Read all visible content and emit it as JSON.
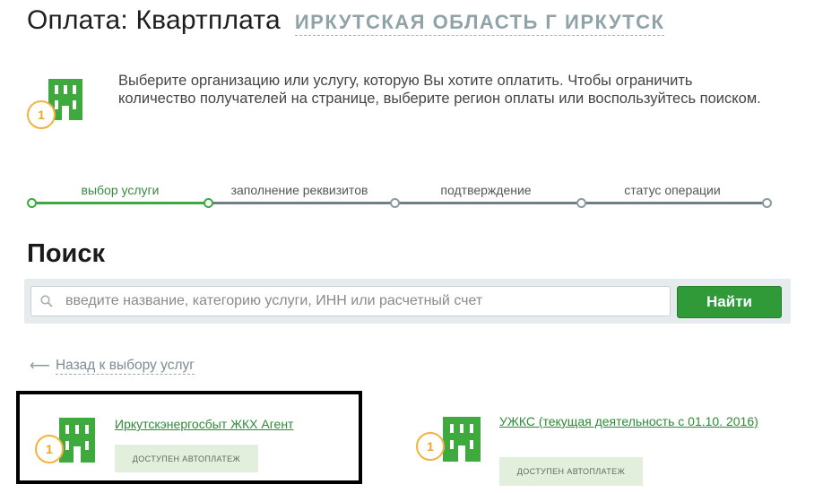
{
  "header": {
    "title": "Оплата: Квартплата",
    "region": "ИРКУТСКАЯ ОБЛАСТЬ Г ИРКУТСК"
  },
  "intro": {
    "text": "Выберите организацию или услугу, которую Вы хотите оплатить. Чтобы ограничить количество получателей на странице, выберите регион оплаты или воспользуйтесь поиском.",
    "icon_number": "1"
  },
  "steps": [
    {
      "label": "выбор услуги",
      "state": "active"
    },
    {
      "label": "заполнение реквизитов",
      "state": "pending"
    },
    {
      "label": "подтверждение",
      "state": "pending"
    },
    {
      "label": "статус операции",
      "state": "pending"
    }
  ],
  "search": {
    "heading": "Поиск",
    "placeholder": "введите название, категорию услуги, ИНН или расчетный счет",
    "value": "",
    "button_label": "Найти"
  },
  "back_link": {
    "arrow": "⟵",
    "label": "Назад к выбору услуг"
  },
  "providers": [
    {
      "name": "Иркутскэнергосбыт ЖКХ Агент",
      "badge": "ДОСТУПЕН АВТОПЛАТЕЖ",
      "icon_number": "1",
      "selected": true
    },
    {
      "name": "УЖКС (текущая деятельность с 01.10. 2016)",
      "badge": "ДОСТУПЕН АВТОПЛАТЕЖ",
      "icon_number": "1",
      "selected": false
    }
  ],
  "colors": {
    "accent_green": "#2f9a37",
    "link_green": "#2e8b32",
    "step_inactive": "#8a9aa0",
    "coin_orange": "#f4b23c",
    "building_green": "#3eaa3e"
  }
}
